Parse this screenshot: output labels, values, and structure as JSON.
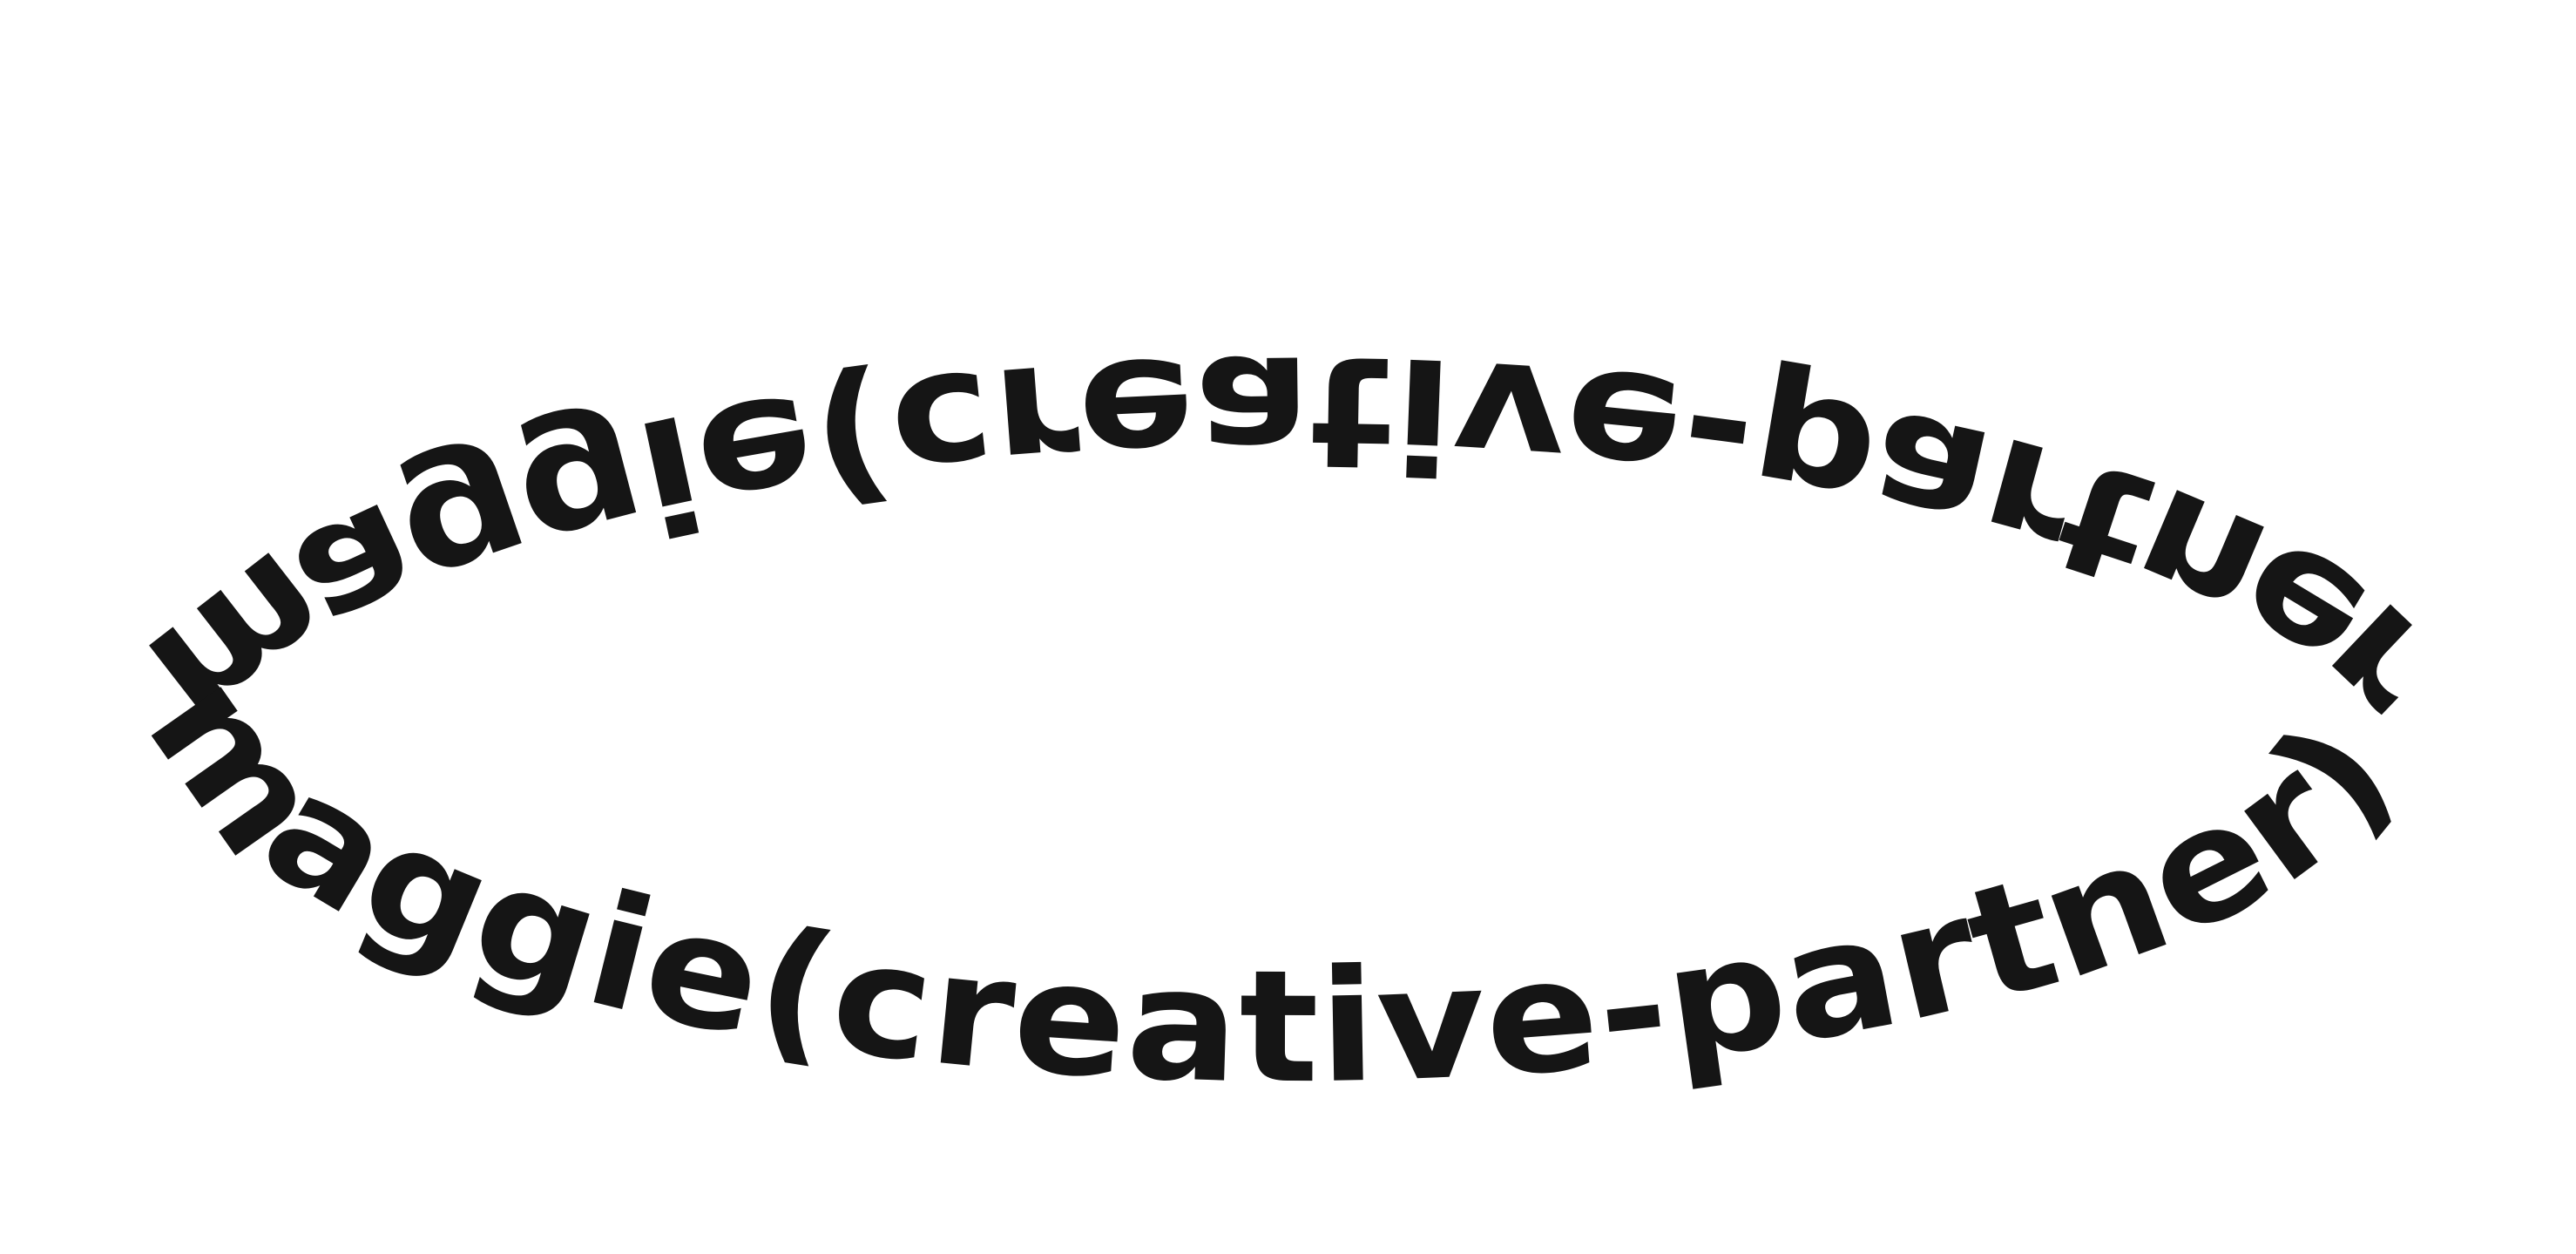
{
  "ring_text": {
    "front": "maggie(creative-partner)",
    "back": "maggie(creative-partner)",
    "color": "#151515"
  }
}
